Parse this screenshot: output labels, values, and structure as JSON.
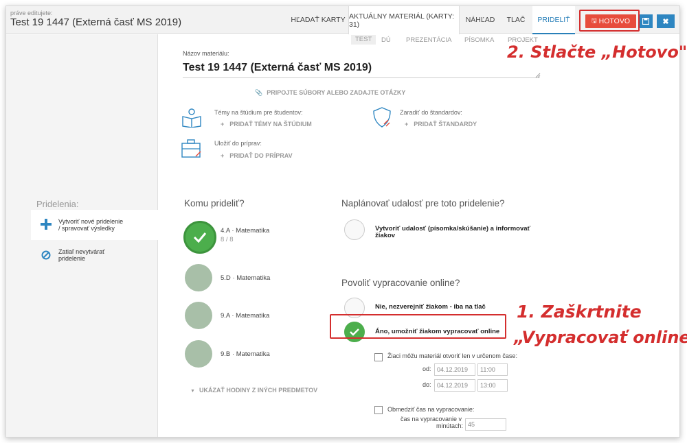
{
  "header": {
    "editing_label": "práve editujete:",
    "doc_title": "Test 19 1447 (Externá časť MS 2019)",
    "nav": {
      "search": "HĽADAŤ KARTY",
      "current": "AKTUÁLNY MATERIÁL (KARTY: 31)",
      "preview": "NÁHĽAD",
      "print": "TLAČ",
      "assign": "PRIDELIŤ"
    },
    "done_label": "HOTOVO"
  },
  "sidebar": {
    "title": "Pridelenia:",
    "items": [
      {
        "label_line1": "Vytvoriť nové pridelenie",
        "label_line2": "/ spravovať výsledky"
      },
      {
        "label_line1": "Zatiaľ nevytvárať",
        "label_line2": "pridelenie"
      }
    ]
  },
  "subtabs": [
    "TEST",
    "DÚ",
    "PREZENTÁCIA",
    "PÍSOMKA",
    "PROJEKT"
  ],
  "material": {
    "name_label": "Názov materiálu:",
    "name_value": "Test 19 1447 (Externá časť MS 2019)",
    "attach_label": "PRIPOJTE SÚBORY ALEBO ZADAJTE OTÁZKY"
  },
  "sections": {
    "topics_label": "Témy na štúdium pre študentov:",
    "topics_add": "PRIDAŤ TÉMY NA ŠTÚDIUM",
    "standards_label": "Zaradiť do štandardov:",
    "standards_add": "PRIDAŤ ŠTANDARDY",
    "prep_label": "Uložiť do príprav:",
    "prep_add": "PRIDAŤ DO PRÍPRAV"
  },
  "assign": {
    "heading": "Komu prideliť?",
    "classes": [
      {
        "name": "4.A · Matematika",
        "count": "8 / 8",
        "selected": true
      },
      {
        "name": "5.D · Matematika",
        "selected": false
      },
      {
        "name": "9.A · Matematika",
        "selected": false
      },
      {
        "name": "9.B · Matematika",
        "selected": false
      }
    ],
    "show_more": "UKÁZAŤ HODINY Z INÝCH PREDMETOV"
  },
  "event": {
    "heading": "Naplánovať udalosť pre toto pridelenie?",
    "option_line1": "Vytvoriť udalosť (písomka/skúšanie) a informovať",
    "option_line2": "žiakov"
  },
  "online": {
    "heading": "Povoliť vypracovanie online?",
    "option_no": "Nie, nezverejniť žiakom - iba na tlač",
    "option_yes": "Áno, umožniť žiakom vypracovať online",
    "time_window_label": "Žiaci môžu materiál otvoriť len v určenom čase:",
    "from_label": "od:",
    "from_date": "04.12.2019",
    "from_time": "11:00",
    "to_label": "do:",
    "to_date": "04.12.2019",
    "to_time": "13:00",
    "limit_label": "Obmedziť čas na vypracovanie:",
    "minutes_label_line1": "čas na vypracovanie v",
    "minutes_label_line2": "minútach:",
    "minutes_value": "45"
  },
  "annotations": {
    "step2": "2. Stlačte „Hotovo\"",
    "step1_line1": "1. Zaškrtnite",
    "step1_line2": "„Vypracovať online\""
  },
  "colors": {
    "accent": "#2e86c1",
    "done": "#e74c3c",
    "highlight": "#d42e2e",
    "check": "#4cae4c"
  }
}
